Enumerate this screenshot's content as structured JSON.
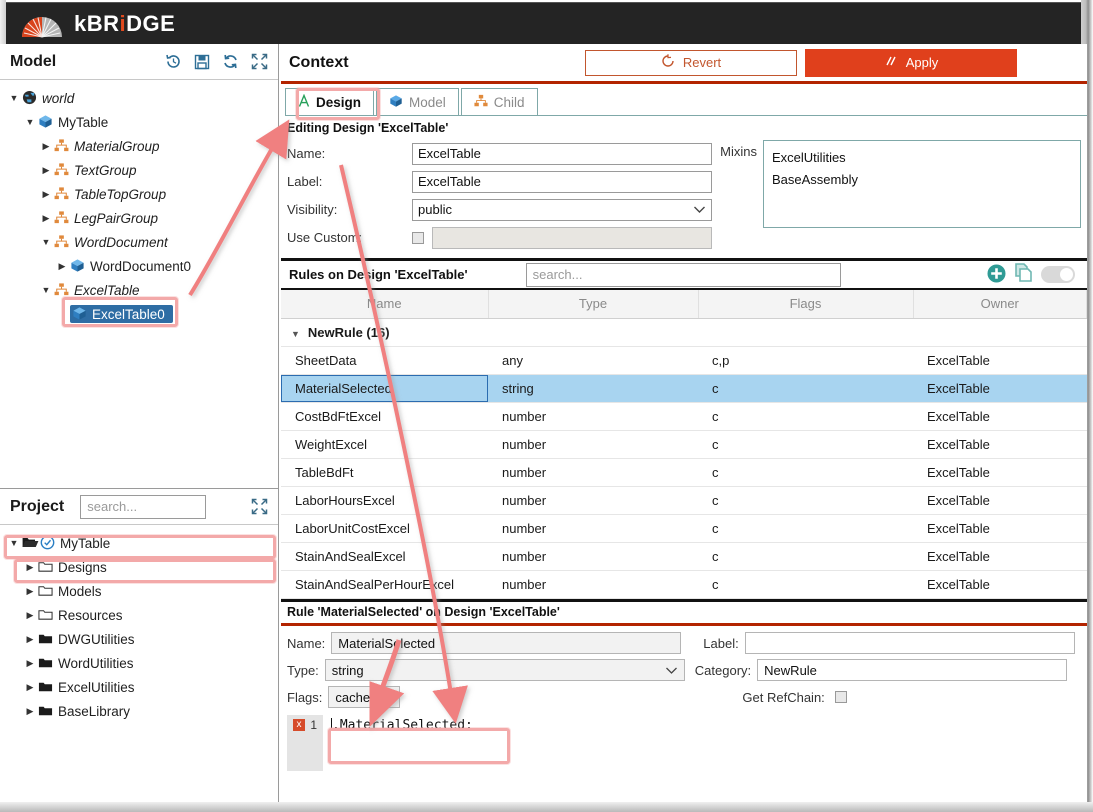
{
  "app": {
    "brand": "kBRiDGE",
    "brand_accent": "#e04a1f"
  },
  "model_panel": {
    "title": "Model",
    "tools": [
      {
        "name": "history-icon",
        "glyph": "↺"
      },
      {
        "name": "save-icon",
        "glyph": "💾"
      },
      {
        "name": "refresh-icon",
        "glyph": "⟳"
      },
      {
        "name": "expand-icon",
        "glyph": "⤢"
      }
    ],
    "tree": [
      {
        "label": "world",
        "depth": 0,
        "icon": "globe-icon",
        "twisty": "down",
        "italic": true,
        "selected": false
      },
      {
        "label": "MyTable",
        "depth": 1,
        "icon": "cube-icon",
        "twisty": "down",
        "italic": false,
        "selected": false
      },
      {
        "label": "MaterialGroup",
        "depth": 2,
        "icon": "group-icon",
        "twisty": "right",
        "italic": true,
        "selected": false
      },
      {
        "label": "TextGroup",
        "depth": 2,
        "icon": "group-icon",
        "twisty": "right",
        "italic": true,
        "selected": false
      },
      {
        "label": "TableTopGroup",
        "depth": 2,
        "icon": "group-icon",
        "twisty": "right",
        "italic": true,
        "selected": false
      },
      {
        "label": "LegPairGroup",
        "depth": 2,
        "icon": "group-icon",
        "twisty": "right",
        "italic": true,
        "selected": false
      },
      {
        "label": "WordDocument",
        "depth": 2,
        "icon": "group-icon",
        "twisty": "down",
        "italic": true,
        "selected": false
      },
      {
        "label": "WordDocument0",
        "depth": 3,
        "icon": "cube-icon",
        "twisty": "right",
        "italic": false,
        "selected": false
      },
      {
        "label": "ExcelTable",
        "depth": 2,
        "icon": "group-icon",
        "twisty": "down",
        "italic": true,
        "selected": false
      },
      {
        "label": "ExcelTable0",
        "depth": 3,
        "icon": "cube-icon",
        "twisty": "none",
        "italic": false,
        "selected": true
      }
    ]
  },
  "project_panel": {
    "title": "Project",
    "search_placeholder": "search...",
    "expand_icon": "expand-icon",
    "tree": [
      {
        "label": "MyTable",
        "depth": 0,
        "icon": "project-open-icon",
        "twisty": "down",
        "check": true,
        "highlight": true
      },
      {
        "label": "Designs",
        "depth": 1,
        "icon": "folder-icon",
        "twisty": "right",
        "check": false,
        "highlight": true
      },
      {
        "label": "Models",
        "depth": 1,
        "icon": "folder-icon",
        "twisty": "right",
        "check": false,
        "highlight": false
      },
      {
        "label": "Resources",
        "depth": 1,
        "icon": "folder-icon",
        "twisty": "right",
        "check": false,
        "highlight": false
      },
      {
        "label": "DWGUtilities",
        "depth": 1,
        "icon": "folder-solid-icon",
        "twisty": "right",
        "check": false,
        "highlight": false
      },
      {
        "label": "WordUtilities",
        "depth": 1,
        "icon": "folder-solid-icon",
        "twisty": "right",
        "check": false,
        "highlight": false
      },
      {
        "label": "ExcelUtilities",
        "depth": 1,
        "icon": "folder-solid-icon",
        "twisty": "right",
        "check": false,
        "highlight": false
      },
      {
        "label": "BaseLibrary",
        "depth": 1,
        "icon": "folder-solid-icon",
        "twisty": "right",
        "check": false,
        "highlight": false
      }
    ]
  },
  "context": {
    "title": "Context",
    "revert_label": "Revert",
    "apply_label": "Apply",
    "revert_icon": "revert-arrow-icon",
    "apply_icon": "apply-slashes-icon",
    "accent_apply": "#e0401c",
    "accent_revert": "#c2562e",
    "tabs": [
      {
        "label": "Design",
        "icon": "design-a-icon",
        "active": true
      },
      {
        "label": "Model",
        "icon": "cube-icon",
        "active": false
      },
      {
        "label": "Child",
        "icon": "group-icon",
        "active": false
      }
    ],
    "editing_header": "Editing Design 'ExcelTable'",
    "form": {
      "name_label": "Name:",
      "name_value": "ExcelTable",
      "label_label": "Label:",
      "label_value": "ExcelTable",
      "visibility_label": "Visibility:",
      "visibility_value": "public",
      "use_custom_label": "Use Custom:",
      "use_custom_value": "",
      "use_custom_checked": false,
      "mixins_label": "Mixins",
      "mixins": [
        "ExcelUtilities",
        "BaseAssembly"
      ]
    }
  },
  "rules": {
    "header": "Rules on Design 'ExcelTable'",
    "search_placeholder": "search...",
    "tools": [
      {
        "name": "add-rule-icon"
      },
      {
        "name": "duplicate-rule-icon"
      },
      {
        "name": "rules-toggle-switch"
      }
    ],
    "columns": [
      "Name",
      "Type",
      "Flags",
      "Owner"
    ],
    "group": {
      "label": "NewRule (16)",
      "expanded": true
    },
    "rows": [
      {
        "name": "SheetData",
        "type": "any",
        "flags": "c,p",
        "owner": "ExcelTable",
        "selected": false
      },
      {
        "name": "MaterialSelected",
        "type": "string",
        "flags": "c",
        "owner": "ExcelTable",
        "selected": true
      },
      {
        "name": "CostBdFtExcel",
        "type": "number",
        "flags": "c",
        "owner": "ExcelTable",
        "selected": false
      },
      {
        "name": "WeightExcel",
        "type": "number",
        "flags": "c",
        "owner": "ExcelTable",
        "selected": false
      },
      {
        "name": "TableBdFt",
        "type": "number",
        "flags": "c",
        "owner": "ExcelTable",
        "selected": false
      },
      {
        "name": "LaborHoursExcel",
        "type": "number",
        "flags": "c",
        "owner": "ExcelTable",
        "selected": false
      },
      {
        "name": "LaborUnitCostExcel",
        "type": "number",
        "flags": "c",
        "owner": "ExcelTable",
        "selected": false
      },
      {
        "name": "StainAndSealExcel",
        "type": "number",
        "flags": "c",
        "owner": "ExcelTable",
        "selected": false
      },
      {
        "name": "StainAndSealPerHourExcel",
        "type": "number",
        "flags": "c",
        "owner": "ExcelTable",
        "selected": false
      }
    ]
  },
  "rule_editor": {
    "header": "Rule 'MaterialSelected' on Design 'ExcelTable'",
    "name_label": "Name:",
    "name_value": "MaterialSelected",
    "label_label": "Label:",
    "label_value": "",
    "type_label": "Type:",
    "type_value": "string",
    "category_label": "Category:",
    "category_value": "NewRule",
    "flags_label": "Flags:",
    "flags_value": "cached",
    "refchain_label": "Get RefChain:",
    "refchain_checked": false,
    "code": {
      "line_number": "1",
      "error_marker": "x",
      "text": ".MaterialSelected;"
    }
  }
}
